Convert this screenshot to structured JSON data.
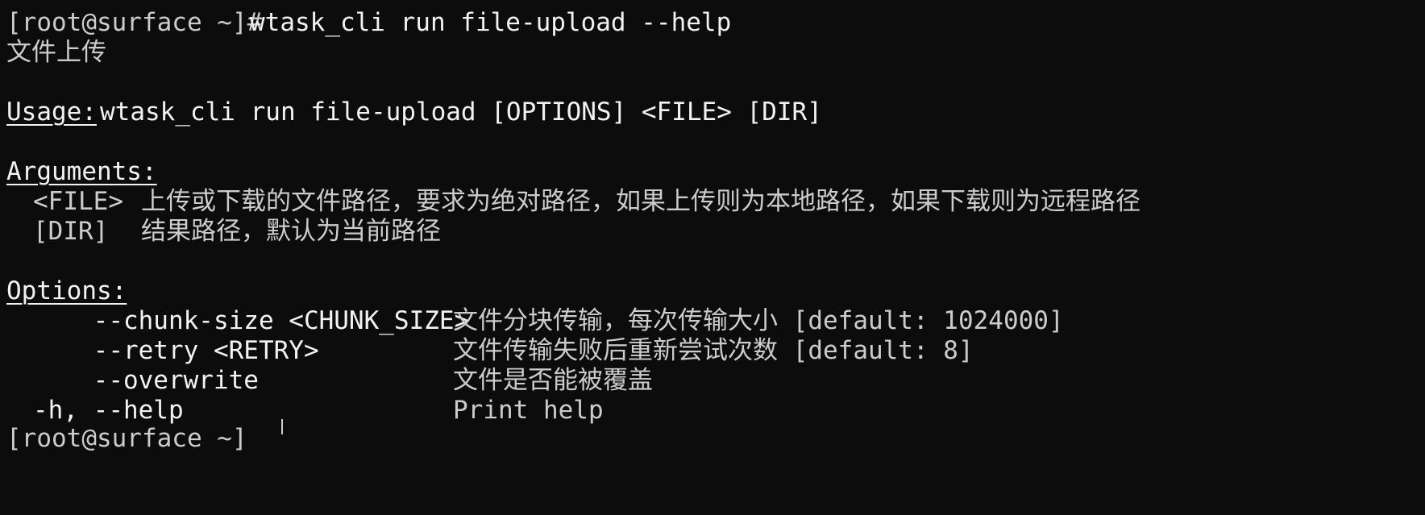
{
  "terminal": {
    "prompt": "[root@surface ~]#",
    "command": "wtask_cli run file-upload --help",
    "description": "文件上传",
    "usage_label": "Usage:",
    "usage_text": "wtask_cli run file-upload [OPTIONS] <FILE> [DIR]",
    "arguments_label": "Arguments:",
    "arguments": [
      {
        "name": "<FILE>",
        "help": "上传或下载的文件路径，要求为绝对路径，如果上传则为本地路径，如果下载则为远程路径"
      },
      {
        "name": "[DIR]",
        "help": "结果路径，默认为当前路径"
      }
    ],
    "options_label": "Options:",
    "options": [
      {
        "flag": "    --chunk-size <CHUNK_SIZE>",
        "help": "文件分块传输，每次传输大小 [default: 1024000]"
      },
      {
        "flag": "    --retry <RETRY>",
        "help": "文件传输失败后重新尝试次数 [default: 8]"
      },
      {
        "flag": "    --overwrite",
        "help": "文件是否能被覆盖"
      },
      {
        "flag": "-h, --help",
        "help": "Print help"
      }
    ],
    "next_prompt_partial": "[root@surface ~]"
  },
  "colors": {
    "background": "#0c0c0c",
    "foreground": "#cccccc",
    "bright": "#f2f2f2"
  }
}
